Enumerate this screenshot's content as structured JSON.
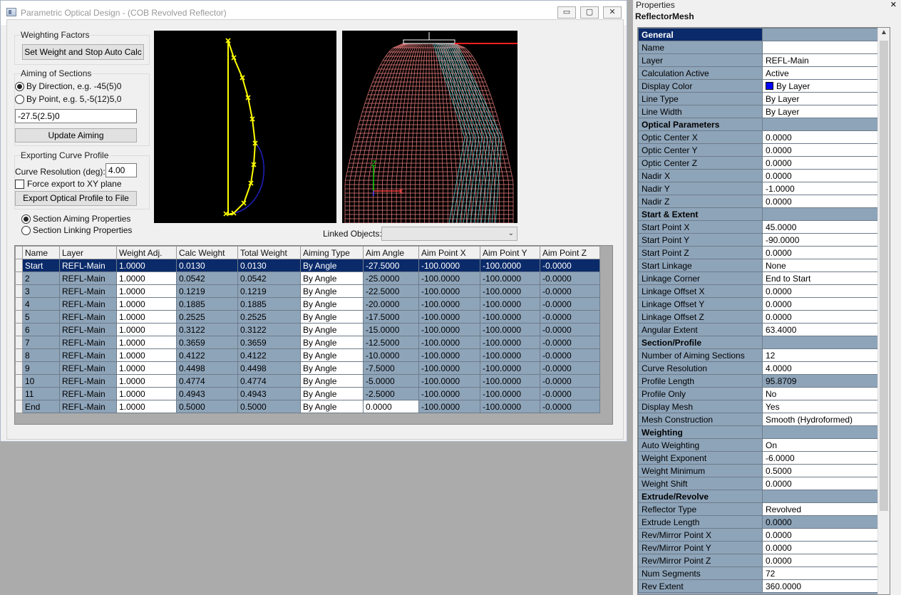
{
  "window": {
    "title": "Parametric Optical Design - (COB Revolved Reflector)",
    "minimize": "▭",
    "maximize": "▢",
    "close": "✕"
  },
  "weighting": {
    "group_label": "Weighting Factors",
    "button": "Set Weight and Stop Auto Calc"
  },
  "aiming": {
    "group_label": "Aiming of Sections",
    "by_direction": "By Direction, e.g. -45(5)0",
    "by_point": "By Point, e.g. 5,-5(12)5,0",
    "value": "-27.5(2.5)0",
    "update_button": "Update Aiming"
  },
  "export": {
    "group_label": "Exporting Curve Profile",
    "resolution_label": "Curve Resolution (deg):",
    "resolution_value": "4.00",
    "force_xy": "Force export to XY plane",
    "export_button": "Export Optical Profile to File"
  },
  "mode": {
    "section_aiming": "Section Aiming Properties",
    "section_linking": "Section Linking Properties"
  },
  "linked_objects_label": "Linked Objects:",
  "grid": {
    "columns": [
      "Name",
      "Layer",
      "Weight Adj.",
      "Calc Weight",
      "Total Weight",
      "Aiming Type",
      "Aim Angle",
      "Aim Point X",
      "Aim Point Y",
      "Aim Point Z"
    ],
    "rows": [
      [
        "Start",
        "REFL-Main",
        "1.0000",
        "0.0130",
        "0.0130",
        "By Angle",
        "-27.5000",
        "-100.0000",
        "-100.0000",
        "-0.0000"
      ],
      [
        "2",
        "REFL-Main",
        "1.0000",
        "0.0542",
        "0.0542",
        "By Angle",
        "-25.0000",
        "-100.0000",
        "-100.0000",
        "-0.0000"
      ],
      [
        "3",
        "REFL-Main",
        "1.0000",
        "0.1219",
        "0.1219",
        "By Angle",
        "-22.5000",
        "-100.0000",
        "-100.0000",
        "-0.0000"
      ],
      [
        "4",
        "REFL-Main",
        "1.0000",
        "0.1885",
        "0.1885",
        "By Angle",
        "-20.0000",
        "-100.0000",
        "-100.0000",
        "-0.0000"
      ],
      [
        "5",
        "REFL-Main",
        "1.0000",
        "0.2525",
        "0.2525",
        "By Angle",
        "-17.5000",
        "-100.0000",
        "-100.0000",
        "-0.0000"
      ],
      [
        "6",
        "REFL-Main",
        "1.0000",
        "0.3122",
        "0.3122",
        "By Angle",
        "-15.0000",
        "-100.0000",
        "-100.0000",
        "-0.0000"
      ],
      [
        "7",
        "REFL-Main",
        "1.0000",
        "0.3659",
        "0.3659",
        "By Angle",
        "-12.5000",
        "-100.0000",
        "-100.0000",
        "-0.0000"
      ],
      [
        "8",
        "REFL-Main",
        "1.0000",
        "0.4122",
        "0.4122",
        "By Angle",
        "-10.0000",
        "-100.0000",
        "-100.0000",
        "-0.0000"
      ],
      [
        "9",
        "REFL-Main",
        "1.0000",
        "0.4498",
        "0.4498",
        "By Angle",
        "-7.5000",
        "-100.0000",
        "-100.0000",
        "-0.0000"
      ],
      [
        "10",
        "REFL-Main",
        "1.0000",
        "0.4774",
        "0.4774",
        "By Angle",
        "-5.0000",
        "-100.0000",
        "-100.0000",
        "-0.0000"
      ],
      [
        "11",
        "REFL-Main",
        "1.0000",
        "0.4943",
        "0.4943",
        "By Angle",
        "-2.5000",
        "-100.0000",
        "-100.0000",
        "-0.0000"
      ],
      [
        "End",
        "REFL-Main",
        "1.0000",
        "0.5000",
        "0.5000",
        "By Angle",
        "0.0000",
        "-100.0000",
        "-100.0000",
        "-0.0000"
      ]
    ]
  },
  "properties": {
    "panel_title": "Properties",
    "close": "✕",
    "object_name": "ReflectorMesh",
    "rows": [
      {
        "k": "General",
        "v": "",
        "type": "gen"
      },
      {
        "k": "Name",
        "v": ""
      },
      {
        "k": "Layer",
        "v": "REFL-Main"
      },
      {
        "k": "Calculation Active",
        "v": "Active"
      },
      {
        "k": "Display Color",
        "v": "By Layer",
        "swatch": "#0000ff"
      },
      {
        "k": "Line Type",
        "v": "By Layer"
      },
      {
        "k": "Line Width",
        "v": "By Layer"
      },
      {
        "k": "Optical Parameters",
        "v": "",
        "type": "cat"
      },
      {
        "k": "Optic Center X",
        "v": "0.0000"
      },
      {
        "k": "Optic Center Y",
        "v": "0.0000"
      },
      {
        "k": "Optic Center Z",
        "v": "0.0000"
      },
      {
        "k": "Nadir X",
        "v": "0.0000"
      },
      {
        "k": "Nadir Y",
        "v": "-1.0000"
      },
      {
        "k": "Nadir Z",
        "v": "0.0000"
      },
      {
        "k": "Start & Extent",
        "v": "",
        "type": "cat"
      },
      {
        "k": "Start Point X",
        "v": "45.0000"
      },
      {
        "k": "Start Point Y",
        "v": "-90.0000"
      },
      {
        "k": "Start Point Z",
        "v": "0.0000"
      },
      {
        "k": "Start Linkage",
        "v": "None"
      },
      {
        "k": "Linkage Corner",
        "v": "End to Start"
      },
      {
        "k": "Linkage Offset X",
        "v": "0.0000"
      },
      {
        "k": "Linkage Offset Y",
        "v": "0.0000"
      },
      {
        "k": "Linkage Offset Z",
        "v": "0.0000"
      },
      {
        "k": "Angular Extent",
        "v": "63.4000"
      },
      {
        "k": "Section/Profile",
        "v": "",
        "type": "cat"
      },
      {
        "k": "Number of Aiming Sections",
        "v": "12"
      },
      {
        "k": "Curve Resolution",
        "v": "4.0000"
      },
      {
        "k": "Profile Length",
        "v": "95.8709",
        "shade": true
      },
      {
        "k": "Profile Only",
        "v": "No"
      },
      {
        "k": "Display Mesh",
        "v": "Yes"
      },
      {
        "k": "Mesh Construction",
        "v": "Smooth (Hydroformed)"
      },
      {
        "k": "Weighting",
        "v": "",
        "type": "cat"
      },
      {
        "k": "Auto Weighting",
        "v": "On"
      },
      {
        "k": "Weight Exponent",
        "v": "-6.0000"
      },
      {
        "k": "Weight Minimum",
        "v": "0.5000"
      },
      {
        "k": "Weight Shift",
        "v": "0.0000"
      },
      {
        "k": "Extrude/Revolve",
        "v": "",
        "type": "cat"
      },
      {
        "k": "Reflector Type",
        "v": "Revolved"
      },
      {
        "k": "Extrude Length",
        "v": "0.0000",
        "shade": true
      },
      {
        "k": "Rev/Mirror Point X",
        "v": "0.0000"
      },
      {
        "k": "Rev/Mirror Point Y",
        "v": "0.0000"
      },
      {
        "k": "Rev/Mirror Point Z",
        "v": "0.0000"
      },
      {
        "k": "Num Segments",
        "v": "72"
      },
      {
        "k": "Rev Extent",
        "v": "360.0000"
      }
    ]
  },
  "axis": {
    "x": "X",
    "z": "Z"
  },
  "colors": {
    "profile": "#ffff00",
    "mesh": "#f08080",
    "rays": "#5fd0d0",
    "selection": "#0a2a6a",
    "grid_cell": "#8ea4b9"
  }
}
